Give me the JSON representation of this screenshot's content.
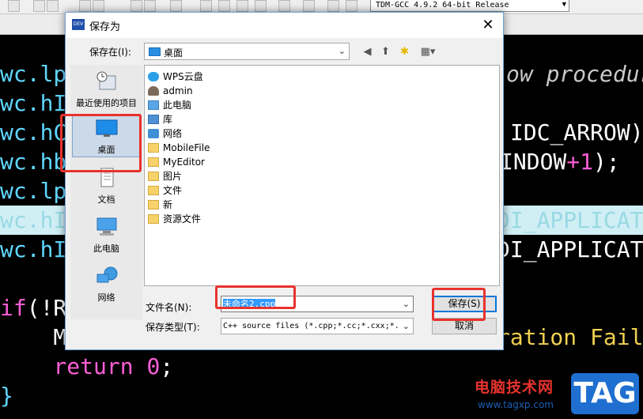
{
  "toolbar": {
    "compiler": "TDM-GCC 4.9.2 64-bit Release"
  },
  "code": {
    "line1_member": "wc.lp",
    "line1_comment": "ow procedur",
    "line2_member": "wc.hI",
    "line3_member": "wc.hC",
    "line3_rest": "IDC_ARROW)",
    "line4_member": "wc.hb",
    "line4_rest_a": "INDOW",
    "line4_plus": "+",
    "line4_num": "1",
    "line4_end": ");",
    "line5_member": "wc.lp",
    "line6_member": "wc.hI",
    "line6_rest": "DI_APPLICAT",
    "line7_member": "wc.hI",
    "line7_rest": "DI_APPLICAT",
    "line8_kw": "if",
    "line8_rest": "(!R",
    "line9_start": "    M",
    "line9_str": "ration Fail",
    "line10_kw": "return",
    "line10_num": "0",
    "line10_end": ";",
    "line11": "}"
  },
  "dialog": {
    "title": "保存为",
    "app_icon_text": "DEV",
    "close_glyph": "✕",
    "save_in_label": "保存在(I):",
    "save_in_value": "桌面",
    "places": [
      {
        "label": "最近使用的项目"
      },
      {
        "label": "桌面"
      },
      {
        "label": "文档"
      },
      {
        "label": "此电脑"
      },
      {
        "label": "网络"
      }
    ],
    "files": [
      {
        "name": "WPS云盘",
        "icon": "cloud-icon"
      },
      {
        "name": "admin",
        "icon": "user-icon"
      },
      {
        "name": "此电脑",
        "icon": "computer-icon"
      },
      {
        "name": "库",
        "icon": "library-icon"
      },
      {
        "name": "网络",
        "icon": "network-icon"
      },
      {
        "name": "MobileFile",
        "icon": "folder-icon"
      },
      {
        "name": "MyEditor",
        "icon": "folder-icon"
      },
      {
        "name": "图片",
        "icon": "folder-icon"
      },
      {
        "name": "文件",
        "icon": "folder-icon"
      },
      {
        "name": "新",
        "icon": "folder-icon"
      },
      {
        "name": "资源文件",
        "icon": "folder-icon"
      }
    ],
    "filename_label": "文件名(N):",
    "filename_value": "未命名2.cpp",
    "filetype_label": "保存类型(T):",
    "filetype_value": "C++ source files (*.cpp;*.cc;*.cxx;*.",
    "save_button": "保存(S)",
    "cancel_button": "取消"
  },
  "watermark": {
    "text": "电脑技术网",
    "url": "www.tagxp.com",
    "badge": "TAG"
  },
  "colors": {
    "highlight": "#e8332d",
    "keyword": "#ff5fd7",
    "member": "#5fd7ff"
  }
}
